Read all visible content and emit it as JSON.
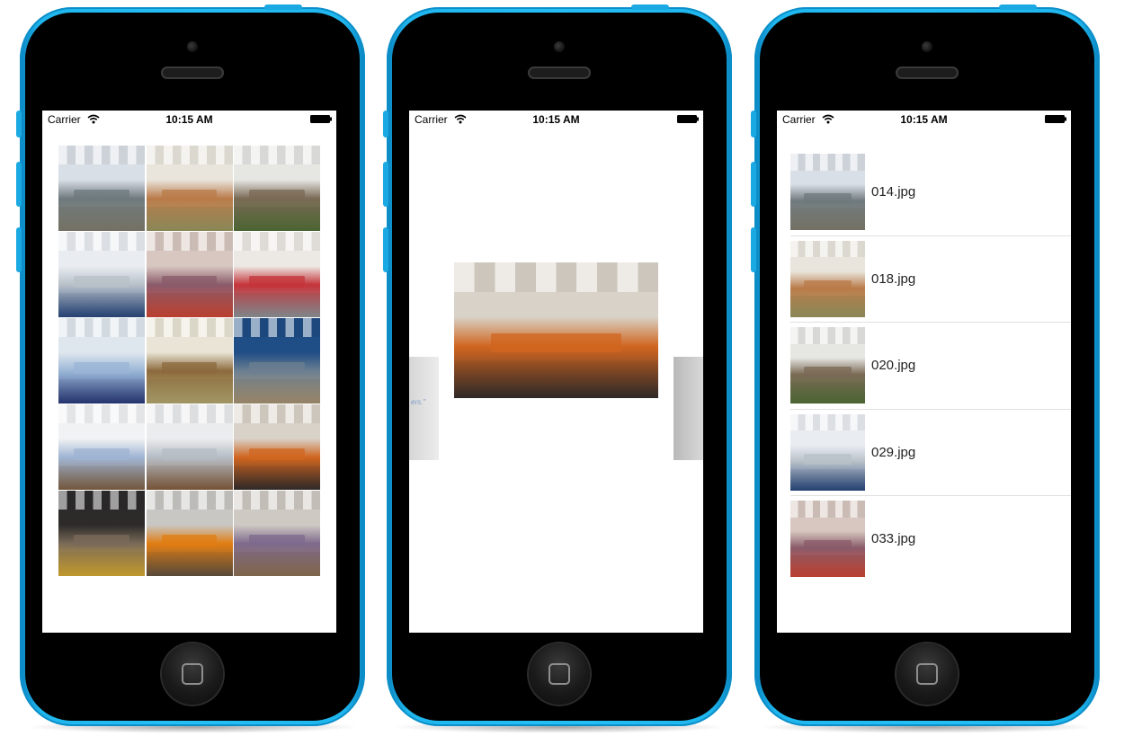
{
  "status_bar": {
    "carrier": "Carrier",
    "time": "10:15 AM"
  },
  "grid_screen": {
    "tiles": [
      {
        "name": "office-open-plan",
        "palette": [
          "#d9dfe6",
          "#6f7a7e",
          "#8d8a7a"
        ]
      },
      {
        "name": "lounge-wood-table",
        "palette": [
          "#e9e5dc",
          "#b97b4a",
          "#a8a46a"
        ]
      },
      {
        "name": "office-plants",
        "palette": [
          "#e6e6e3",
          "#7a6a55",
          "#5c7a3e"
        ]
      },
      {
        "name": "open-office-blue-chairs",
        "palette": [
          "#e9edf2",
          "#b8c0c8",
          "#2d4f8a"
        ]
      },
      {
        "name": "library-wall-graphic",
        "palette": [
          "#d7c7c0",
          "#8a5b6a",
          "#e04e3a"
        ]
      },
      {
        "name": "glass-meeting-room",
        "palette": [
          "#ece9e4",
          "#c4343a",
          "#9aa1a6"
        ]
      },
      {
        "name": "white-office-desk",
        "palette": [
          "#dfe7ee",
          "#9ab6d6",
          "#2c3f86"
        ]
      },
      {
        "name": "meeting-table-tree",
        "palette": [
          "#e9e4d5",
          "#8c6a3d",
          "#c4b67a"
        ]
      },
      {
        "name": "blue-wall-lounge",
        "palette": [
          "#1f4d86",
          "#6c7f90",
          "#b7a07c"
        ]
      },
      {
        "name": "whiteboard-corridor",
        "palette": [
          "#f1f2f4",
          "#9fb4d3",
          "#8b6a4a"
        ]
      },
      {
        "name": "glass-room-wood-floor",
        "palette": [
          "#eaecee",
          "#b5bcc4",
          "#8e6543"
        ]
      },
      {
        "name": "cafe-round-tables",
        "palette": [
          "#d9d2c8",
          "#d0651f",
          "#3a3230"
        ]
      },
      {
        "name": "chalkboard-beanbags",
        "palette": [
          "#2c2b2a",
          "#7a6a58",
          "#e8b836"
        ]
      },
      {
        "name": "orange-kitchen",
        "palette": [
          "#c8c7c4",
          "#e07d13",
          "#6b5a45"
        ]
      },
      {
        "name": "stairs-purple-light",
        "palette": [
          "#cfc9c3",
          "#7e6a8c",
          "#9a7a5a"
        ]
      }
    ]
  },
  "carousel_screen": {
    "main_image": {
      "name": "cafe-round-tables",
      "palette": [
        "#d9d2c8",
        "#d0651f",
        "#3a3230"
      ]
    },
    "peek_left_text": "ers.\"",
    "peek_right_name": "grey-wall-image"
  },
  "list_screen": {
    "rows": [
      {
        "label": "014.jpg",
        "palette": [
          "#d9dfe6",
          "#6f7a7e",
          "#8d8a7a"
        ]
      },
      {
        "label": "018.jpg",
        "palette": [
          "#e9e5dc",
          "#b97b4a",
          "#a8a46a"
        ]
      },
      {
        "label": "020.jpg",
        "palette": [
          "#e6e6e3",
          "#7a6a55",
          "#5c7a3e"
        ]
      },
      {
        "label": "029.jpg",
        "palette": [
          "#e9edf2",
          "#b8c0c8",
          "#2d4f8a"
        ]
      },
      {
        "label": "033.jpg",
        "palette": [
          "#d7c7c0",
          "#8a5b6a",
          "#e04e3a"
        ]
      }
    ]
  },
  "device": {
    "shell_color": "#25bff5"
  }
}
